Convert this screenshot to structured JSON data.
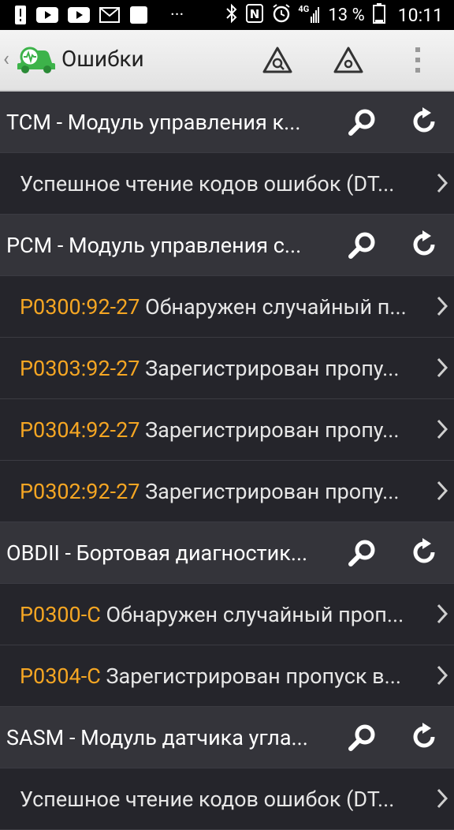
{
  "status_bar": {
    "battery_percent": "13 %",
    "time": "10:11",
    "network": "4G",
    "more_dots": "···"
  },
  "toolbar": {
    "back": "‹",
    "title": "Ошибки"
  },
  "groups": [
    {
      "header": "TCM - Модуль управления к...",
      "items": [
        {
          "code": "",
          "desc": "Успешное чтение кодов ошибок (DT..."
        }
      ]
    },
    {
      "header": "PCM - Модуль управления с...",
      "items": [
        {
          "code": "P0300:92-27",
          "desc": " Обнаружен случайный п..."
        },
        {
          "code": "P0303:92-27",
          "desc": " Зарегистрирован пропу..."
        },
        {
          "code": "P0304:92-27",
          "desc": " Зарегистрирован пропу..."
        },
        {
          "code": "P0302:92-27",
          "desc": " Зарегистрирован пропу..."
        }
      ]
    },
    {
      "header": "OBDII - Бортовая диагностик...",
      "items": [
        {
          "code": "P0300-C",
          "desc": " Обнаружен случайный проп..."
        },
        {
          "code": "P0304-C",
          "desc": " Зарегистрирован пропуск в..."
        }
      ]
    },
    {
      "header": "SASM - Модуль датчика угла...",
      "items": [
        {
          "code": "",
          "desc": "Успешное чтение кодов ошибок (DT..."
        }
      ]
    }
  ],
  "colors": {
    "accent_code": "#f5a623",
    "background": "#25252b",
    "header_background": "#34343a",
    "logo_green": "#3db34a"
  }
}
